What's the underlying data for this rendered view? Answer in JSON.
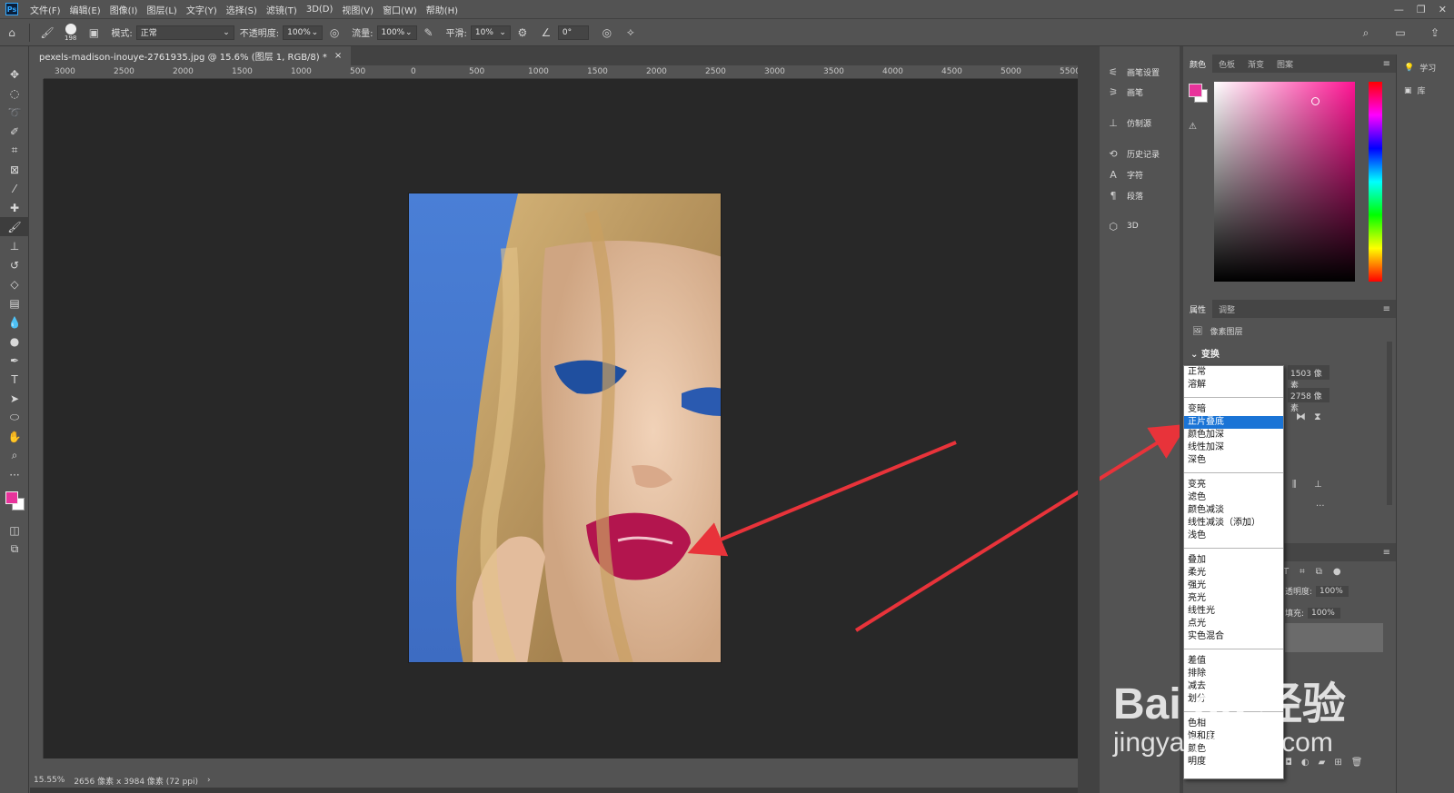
{
  "app": {
    "logo_text": "Ps",
    "menus": [
      "文件(F)",
      "编辑(E)",
      "图像(I)",
      "图层(L)",
      "文字(Y)",
      "选择(S)",
      "滤镜(T)",
      "3D(D)",
      "视图(V)",
      "窗口(W)",
      "帮助(H)"
    ],
    "window_controls": [
      "—",
      "❐",
      "✕"
    ]
  },
  "options_bar": {
    "brush_size": "198",
    "mode_label": "模式:",
    "mode_value": "正常",
    "opacity_label": "不透明度:",
    "opacity_value": "100%",
    "flow_label": "流量:",
    "flow_value": "100%",
    "smoothing_label": "平滑:",
    "smoothing_value": "10%",
    "angle_value": "0°"
  },
  "document": {
    "tab_title": "pexels-madison-inouye-2761935.jpg @ 15.6% (图层 1, RGB/8) *",
    "close_glyph": "×",
    "ruler_labels": [
      "3000",
      "2500",
      "2000",
      "1500",
      "1000",
      "500",
      "0",
      "500",
      "1000",
      "1500",
      "2000",
      "2500",
      "3000",
      "3500",
      "4000",
      "4500",
      "5000",
      "5500"
    ],
    "zoom": "15.55%",
    "doc_info": "2656 像素 x 3984 像素 (72 ppi)",
    "status_arrow": "›"
  },
  "collapsed_panels": [
    {
      "label": "画笔设置",
      "icon": "brush-settings-icon"
    },
    {
      "label": "画笔",
      "icon": "brush-icon"
    },
    {
      "label": "仿制源",
      "icon": "clone-source-icon"
    },
    {
      "label": "历史记录",
      "icon": "history-icon"
    },
    {
      "label": "字符",
      "icon": "character-icon"
    },
    {
      "label": "段落",
      "icon": "paragraph-icon"
    },
    {
      "label": "3D",
      "icon": "3d-icon"
    }
  ],
  "color_panel": {
    "tabs": [
      "颜色",
      "色板",
      "渐变",
      "图案"
    ],
    "foreground": "#e8339b",
    "background": "#ffffff",
    "hue_color": "#ff1493"
  },
  "learn_panel": {
    "items": [
      "学习",
      "库"
    ]
  },
  "properties_panel": {
    "tabs": [
      "属性",
      "调整"
    ],
    "layer_type": "像素图层",
    "section": "变换",
    "width_value": "1503 像素",
    "height_value": "2758 像素"
  },
  "layers_panel": {
    "opacity_label": "透明度:",
    "opacity_value": "100%",
    "fill_label": "填充:",
    "fill_value": "100%"
  },
  "blend_dropdown": {
    "groups": [
      [
        "正常",
        "溶解"
      ],
      [
        "变暗",
        "正片叠底",
        "颜色加深",
        "线性加深",
        "深色"
      ],
      [
        "变亮",
        "滤色",
        "颜色减淡",
        "线性减淡（添加）",
        "浅色"
      ],
      [
        "叠加",
        "柔光",
        "强光",
        "亮光",
        "线性光",
        "点光",
        "实色混合"
      ],
      [
        "差值",
        "排除",
        "减去",
        "划分"
      ],
      [
        "色相",
        "饱和度",
        "颜色",
        "明度"
      ]
    ],
    "selected": "正片叠底"
  },
  "watermark": {
    "brand": "Bai du 经验",
    "url": "jingyan.baidu.com"
  },
  "annotation": {
    "arrow_color": "#e8333a"
  }
}
